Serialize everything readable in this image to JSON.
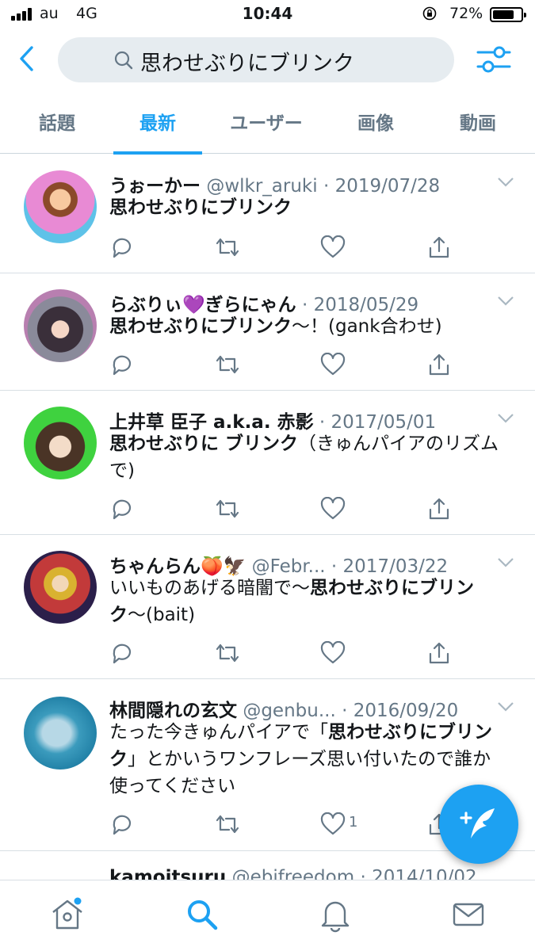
{
  "status_bar": {
    "carrier": "au",
    "network": "4G",
    "time": "10:44",
    "battery": "72%"
  },
  "search": {
    "query": "思わせぶりにブリンク"
  },
  "tabs": [
    {
      "label": "話題",
      "active": false
    },
    {
      "label": "最新",
      "active": true
    },
    {
      "label": "ユーザー",
      "active": false
    },
    {
      "label": "画像",
      "active": false
    },
    {
      "label": "動画",
      "active": false
    }
  ],
  "tweets": [
    {
      "name": "うぉーかー",
      "handle": "@wlkr_aruki",
      "date": "2019/07/28",
      "text_parts": [
        "思わせぶりにブリンク"
      ],
      "likes": ""
    },
    {
      "name": "らぶりぃ💜ぎらにゃん",
      "handle": "",
      "date": "2018/05/29",
      "text_parts": [
        "思わせぶりにブリンク",
        "〜！(gank合わせ)"
      ],
      "likes": ""
    },
    {
      "name": "上井草 臣子 a.k.a. 赤影",
      "handle": "",
      "date": "2017/05/01",
      "text_parts": [
        "思わせぶりに ブリンク",
        "（きゅんパイアのリズムで)"
      ],
      "likes": ""
    },
    {
      "name": "ちゃんらん🍑🦅",
      "handle": "@Febr...",
      "date": "2017/03/22",
      "text_parts": [
        "いいものあげる暗闇で〜",
        "思わせぶりにブリンク",
        "〜(bait)"
      ],
      "likes": ""
    },
    {
      "name": "林間隠れの玄文",
      "handle": "@genbu...",
      "date": "2016/09/20",
      "text_parts": [
        "たった今きゅんパイアで「",
        "思わせぶりにブリンク",
        "」とかいうワンフレーズ思い付いたので誰か使ってください"
      ],
      "likes": "1"
    },
    {
      "name": "kamoitsuru",
      "handle": "@ebifreedom",
      "date": "2014/10/02",
      "text_parts": [],
      "likes": ""
    }
  ],
  "colors": {
    "accent": "#1da1f2",
    "secondary_text": "#657786",
    "search_bg": "#e6ecf0"
  },
  "icons": {
    "header": [
      "back-arrow-icon",
      "search-icon",
      "filter-sliders-icon"
    ],
    "tweet_actions": [
      "reply-icon",
      "retweet-icon",
      "like-heart-icon",
      "share-icon"
    ],
    "bottom_nav": [
      "home-icon",
      "search-icon",
      "notifications-bell-icon",
      "messages-envelope-icon"
    ],
    "fab": "compose-tweet-icon"
  }
}
